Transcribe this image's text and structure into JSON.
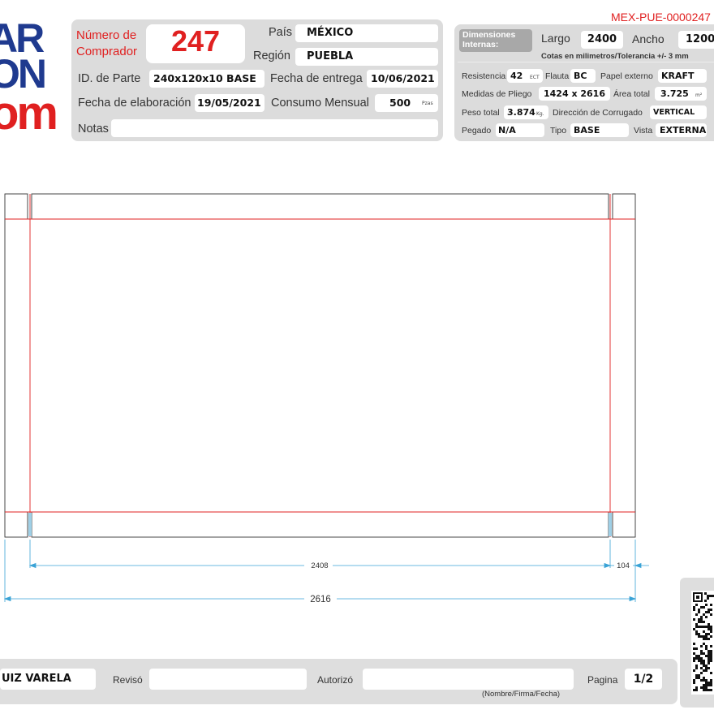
{
  "logo": {
    "line1": "AR",
    "line2": "ON",
    "line3": "om"
  },
  "buyer": {
    "label_line1": "Número de",
    "label_line2": "Comprador",
    "number": "247"
  },
  "pais": {
    "label": "País",
    "value": "MÉXICO"
  },
  "region": {
    "label": "Región",
    "value": "PUEBLA"
  },
  "part_id": {
    "label": "ID. de Parte",
    "value": "240x120x10 BASE"
  },
  "delivery": {
    "label": "Fecha de entrega",
    "value": "10/06/2021"
  },
  "elaboration": {
    "label": "Fecha de elaboración",
    "value": "19/05/2021"
  },
  "consumption": {
    "label": "Consumo Mensual",
    "value": "500",
    "unit": "Pzas"
  },
  "notes": {
    "label": "Notas",
    "value": ""
  },
  "doc_code": "MEX-PUE-0000247",
  "internal_dims": {
    "label_line1": "Dimensiones",
    "label_line2": "Internas:",
    "largo_label": "Largo",
    "largo": "2400",
    "ancho_label": "Ancho",
    "ancho": "1200",
    "note": "Cotas en milimetros/Tolerancia +/- 3 mm"
  },
  "specs": {
    "resistencia_label": "Resistencia",
    "resistencia": "42",
    "resistencia_unit": "ECT",
    "flauta_label": "Flauta",
    "flauta": "BC",
    "papel_label": "Papel externo",
    "papel": "KRAFT",
    "pliego_label": "Medidas de Pliego",
    "pliego": "1424 x 2616",
    "area_label": "Área total",
    "area": "3.725",
    "area_unit": "m²",
    "peso_label": "Peso total",
    "peso": "3.874",
    "peso_unit": "Kg.",
    "direccion_label": "Dirección de Corrugado",
    "direccion": "VERTICAL",
    "pegado_label": "Pegado",
    "pegado": "N/A",
    "tipo_label": "Tipo",
    "tipo": "BASE",
    "vista_label": "Vista",
    "vista": "EXTERNA"
  },
  "drawing": {
    "dim_inner": "2408",
    "dim_flap": "104",
    "dim_total": "2616"
  },
  "footer": {
    "designer": "UIZ VARELA",
    "reviso_label": "Revisó",
    "reviso": "",
    "autorizo_label": "Autorizó",
    "autorizo": "",
    "signature_note": "(Nombre/Firma/Fecha)",
    "page_label": "Pagina",
    "page": "1/2"
  },
  "colors": {
    "accent_red": "#e02020",
    "logo_blue": "#1f3a8f",
    "dimension_blue": "#3aa3d6",
    "panel_gray": "#dcdcdc"
  }
}
